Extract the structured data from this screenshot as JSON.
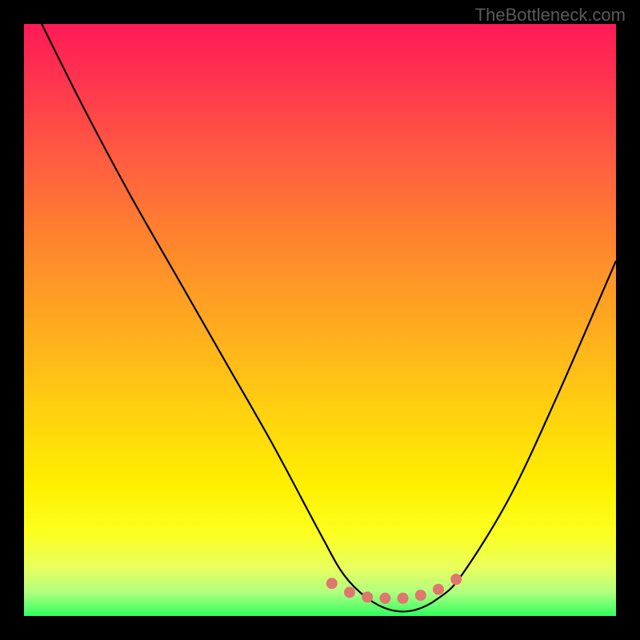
{
  "watermark": "TheBottleneck.com",
  "chart_data": {
    "type": "line",
    "title": "",
    "xlabel": "",
    "ylabel": "",
    "xlim": [
      0,
      100
    ],
    "ylim": [
      0,
      100
    ],
    "series": [
      {
        "name": "bottleneck-curve",
        "x": [
          3,
          10,
          18,
          26,
          34,
          42,
          50,
          54,
          58,
          62,
          66,
          70,
          74,
          82,
          90,
          100
        ],
        "values": [
          100,
          86,
          71,
          57,
          43,
          29,
          14,
          7,
          3,
          1,
          1,
          3,
          7,
          20,
          37,
          60
        ]
      }
    ],
    "markers": {
      "name": "optimal-range-dots",
      "x": [
        52,
        55,
        58,
        61,
        64,
        67,
        70,
        73
      ],
      "values": [
        5.5,
        4.0,
        3.2,
        3.0,
        3.0,
        3.5,
        4.5,
        6.2
      ],
      "color": "#e0766e",
      "radius_px": 7
    },
    "gradient_stops": [
      {
        "pct": 0,
        "color": "#ff1a56"
      },
      {
        "pct": 50,
        "color": "#ffa820"
      },
      {
        "pct": 78,
        "color": "#fff000"
      },
      {
        "pct": 100,
        "color": "#30ff60"
      }
    ]
  }
}
